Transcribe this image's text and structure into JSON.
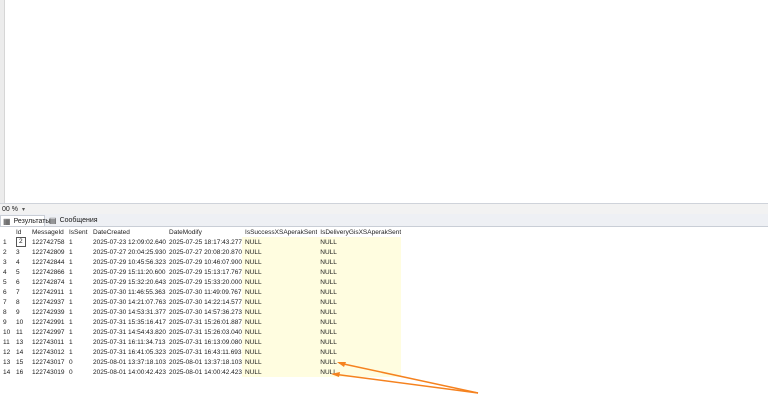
{
  "zoom": {
    "value": "00 %",
    "caret": "▾"
  },
  "tabs": [
    {
      "label": "Результаты",
      "icon": "grid-icon"
    },
    {
      "label": "Сообщения",
      "icon": "message-icon"
    }
  ],
  "grid": {
    "columns": [
      "Id",
      "MessageId",
      "IsSent",
      "DateCreated",
      "DateModify",
      "IsSuccessXSAperakSent",
      "IsDeliveryGisXSAperakSent"
    ],
    "rows": [
      [
        "1",
        "2",
        "122742758",
        "1",
        "2025-07-23 12:09:02.640",
        "2025-07-25 18:17:43.277",
        "NULL",
        "NULL"
      ],
      [
        "2",
        "3",
        "122742809",
        "1",
        "2025-07-27 20:04:25.930",
        "2025-07-27 20:08:20.870",
        "NULL",
        "NULL"
      ],
      [
        "3",
        "4",
        "122742844",
        "1",
        "2025-07-29 10:45:56.323",
        "2025-07-29 10:46:07.900",
        "NULL",
        "NULL"
      ],
      [
        "4",
        "5",
        "122742866",
        "1",
        "2025-07-29 15:11:20.600",
        "2025-07-29 15:13:17.767",
        "NULL",
        "NULL"
      ],
      [
        "5",
        "6",
        "122742874",
        "1",
        "2025-07-29 15:32:20.643",
        "2025-07-29 15:33:20.000",
        "NULL",
        "NULL"
      ],
      [
        "6",
        "7",
        "122742911",
        "1",
        "2025-07-30 11:46:55.363",
        "2025-07-30 11:49:09.767",
        "NULL",
        "NULL"
      ],
      [
        "7",
        "8",
        "122742937",
        "1",
        "2025-07-30 14:21:07.763",
        "2025-07-30 14:22:14.577",
        "NULL",
        "NULL"
      ],
      [
        "8",
        "9",
        "122742939",
        "1",
        "2025-07-30 14:53:31.377",
        "2025-07-30 14:57:36.273",
        "NULL",
        "NULL"
      ],
      [
        "9",
        "10",
        "122742991",
        "1",
        "2025-07-31 15:35:16.417",
        "2025-07-31 15:26:01.887",
        "NULL",
        "NULL"
      ],
      [
        "10",
        "11",
        "122742997",
        "1",
        "2025-07-31 14:54:43.820",
        "2025-07-31 15:26:03.040",
        "NULL",
        "NULL"
      ],
      [
        "11",
        "13",
        "122743011",
        "1",
        "2025-07-31 16:11:34.713",
        "2025-07-31 16:13:09.080",
        "NULL",
        "NULL"
      ],
      [
        "12",
        "14",
        "122743012",
        "1",
        "2025-07-31 16:41:05.323",
        "2025-07-31 16:43:11.693",
        "NULL",
        "NULL"
      ],
      [
        "13",
        "15",
        "122743017",
        "0",
        "2025-08-01 13:37:18.103",
        "2025-08-01 13:37:18.103",
        "NULL",
        "NULL"
      ],
      [
        "14",
        "16",
        "122743019",
        "0",
        "2025-08-01 14:00:42.423",
        "2025-08-01 14:00:42.423",
        "NULL",
        "NULL"
      ]
    ]
  },
  "colors": {
    "highlight_cells": "#fffde0",
    "arrow": "#f5821f"
  }
}
